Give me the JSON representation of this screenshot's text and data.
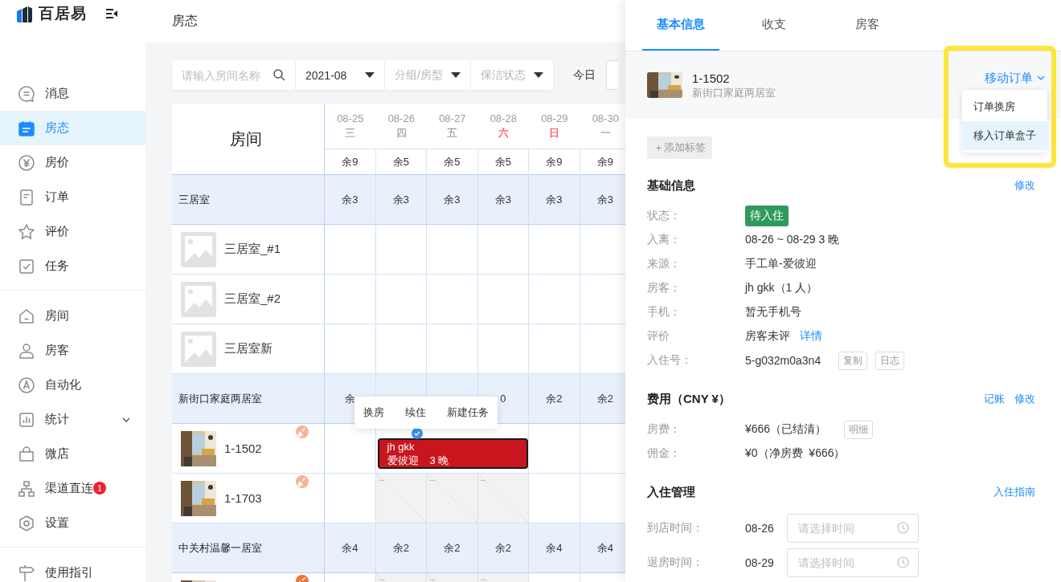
{
  "sidebar": {
    "brand": "百居易",
    "groups": [
      {
        "items": [
          {
            "label": "消息",
            "selected": false,
            "submenu": false
          },
          {
            "label": "房态",
            "selected": true,
            "submenu": false
          },
          {
            "label": "房价",
            "selected": false,
            "submenu": false
          },
          {
            "label": "订单",
            "selected": false,
            "submenu": false
          },
          {
            "label": "评价",
            "selected": false,
            "submenu": false
          },
          {
            "label": "任务",
            "selected": false,
            "submenu": false
          }
        ]
      },
      {
        "items": [
          {
            "label": "房间",
            "selected": false,
            "submenu": false
          },
          {
            "label": "房客",
            "selected": false,
            "submenu": false
          },
          {
            "label": "自动化",
            "selected": false,
            "submenu": false
          },
          {
            "label": "统计",
            "selected": false,
            "submenu": true
          },
          {
            "label": "微店",
            "selected": false,
            "submenu": false
          },
          {
            "label": "渠道直连",
            "selected": false,
            "submenu": false,
            "badge": "1"
          },
          {
            "label": "设置",
            "selected": false,
            "submenu": false
          }
        ]
      },
      {
        "items": [
          {
            "label": "使用指引",
            "selected": false,
            "submenu": false
          }
        ]
      }
    ]
  },
  "page": {
    "title": "房态"
  },
  "toolbar": {
    "search": {
      "placeholder": "请输入房间名称"
    },
    "month": "2021-08",
    "group_filter": "分组/房型",
    "cleaning_filter": "保洁状态",
    "today": "今日"
  },
  "table": {
    "corner": "房间",
    "dates": [
      {
        "date": "08-25",
        "weekday": "三",
        "weekend": false
      },
      {
        "date": "08-26",
        "weekday": "四",
        "weekend": false
      },
      {
        "date": "08-27",
        "weekday": "五",
        "weekend": false
      },
      {
        "date": "08-28",
        "weekday": "六",
        "weekend": true
      },
      {
        "date": "08-29",
        "weekday": "日",
        "weekend": true
      },
      {
        "date": "08-30",
        "weekday": "一",
        "weekend": false
      }
    ],
    "totals": [
      "余9",
      "余5",
      "余5",
      "余5",
      "余9",
      "余9"
    ],
    "rows": [
      {
        "kind": "group",
        "name": "三居室",
        "cells": [
          "余3",
          "余3",
          "余3",
          "余3",
          "余3",
          "余3"
        ]
      },
      {
        "kind": "room",
        "name": "三居室_#1",
        "photo": false,
        "cells": [
          {
            "kind": "empty"
          },
          {
            "kind": "empty"
          },
          {
            "kind": "empty"
          },
          {
            "kind": "empty"
          },
          {
            "kind": "empty"
          },
          {
            "kind": "empty"
          }
        ]
      },
      {
        "kind": "room",
        "name": "三居室_#2",
        "photo": false,
        "cells": [
          {
            "kind": "empty"
          },
          {
            "kind": "empty"
          },
          {
            "kind": "empty"
          },
          {
            "kind": "empty"
          },
          {
            "kind": "empty"
          },
          {
            "kind": "empty"
          }
        ]
      },
      {
        "kind": "room",
        "name": "三居室新",
        "photo": false,
        "cells": [
          {
            "kind": "empty"
          },
          {
            "kind": "empty"
          },
          {
            "kind": "empty"
          },
          {
            "kind": "empty"
          },
          {
            "kind": "empty"
          },
          {
            "kind": "empty"
          }
        ]
      },
      {
        "kind": "group",
        "name": "新街口家庭两居室",
        "cells": [
          "余",
          null,
          null,
          "0",
          "余2",
          "余2"
        ]
      },
      {
        "kind": "room",
        "name": "1-1502",
        "photo": true,
        "cleaning": {
          "color": "#f6b496"
        },
        "cells": [
          {
            "kind": "empty"
          },
          {
            "kind": "booking",
            "guest": "jh gkk",
            "channel": "爱彼迎",
            "nights": "3 晚",
            "selected": true,
            "menu": [
              "换房",
              "续住",
              "新建任务"
            ]
          },
          {
            "kind": "booked"
          },
          {
            "kind": "booked"
          },
          {
            "kind": "empty"
          },
          {
            "kind": "empty"
          }
        ]
      },
      {
        "kind": "room",
        "name": "1-1703",
        "photo": true,
        "cleaning": {
          "color": "#f6b496"
        },
        "cells": [
          {
            "kind": "empty"
          },
          {
            "kind": "blocked",
            "note": "..."
          },
          {
            "kind": "blocked",
            "note": "..."
          },
          {
            "kind": "blocked",
            "note": "..."
          },
          {
            "kind": "empty"
          },
          {
            "kind": "empty"
          }
        ]
      },
      {
        "kind": "group",
        "name": "中关村温馨一居室",
        "cells": [
          "余4",
          "余2",
          "余2",
          "余2",
          "余4",
          "余4"
        ]
      },
      {
        "kind": "room",
        "photo": true,
        "cleaning": {
          "color": "#ef7636"
        },
        "cells": [
          {
            "kind": "empty"
          },
          {
            "kind": "blocked",
            "note": "..."
          },
          {
            "kind": "blocked",
            "note": "..."
          },
          {
            "kind": "blocked",
            "note": "..."
          },
          {
            "kind": "empty"
          },
          {
            "kind": "empty"
          }
        ]
      }
    ]
  },
  "order_panel": {
    "tabs": [
      {
        "label": "基本信息",
        "selected": true
      },
      {
        "label": "收支",
        "selected": false
      },
      {
        "label": "房客",
        "selected": false
      }
    ],
    "room": {
      "name": "1-1502",
      "group": "新街口家庭两居室"
    },
    "move_menu": {
      "label": "移动订单",
      "expanded": true,
      "highlighted": true,
      "options": [
        {
          "label": "订单换房",
          "selected": false
        },
        {
          "label": "移入订单盒子",
          "selected": true
        }
      ]
    },
    "add_tag": "＋添加标签",
    "sections": [
      {
        "title": "基础信息",
        "actions": [
          "修改"
        ],
        "fields": [
          {
            "kind": "status",
            "label": "状态：",
            "value": "待入住"
          },
          {
            "kind": "text",
            "label": "入离：",
            "value": "08-26 ~ 08-29 3 晚"
          },
          {
            "kind": "text",
            "label": "来源：",
            "value": "手工单-爱彼迎"
          },
          {
            "kind": "text",
            "label": "房客：",
            "value": "jh gkk（1 人）"
          },
          {
            "kind": "text",
            "label": "手机：",
            "value": "暂无手机号"
          },
          {
            "kind": "text",
            "label": "评价",
            "value": "房客未评",
            "link": "详情"
          },
          {
            "kind": "text",
            "label": "入住号：",
            "value": "5-g032m0a3n4",
            "buttons": [
              "复制",
              "日志"
            ]
          }
        ]
      },
      {
        "title": "费用（CNY ¥）",
        "actions": [
          "记账",
          "修改"
        ],
        "fields": [
          {
            "kind": "text",
            "label": "房费：",
            "value": "¥666（已结清）",
            "buttons": [
              "明细"
            ]
          },
          {
            "kind": "text",
            "label": "佣金：",
            "value": "¥0（净房费  ¥666）"
          }
        ]
      },
      {
        "title": "入住管理",
        "actions": [
          "入住指南"
        ],
        "fields": [
          {
            "kind": "time",
            "label": "到店时间：",
            "value": "08-26",
            "placeholder": "请选择时间"
          },
          {
            "kind": "time",
            "label": "退房时间：",
            "value": "08-29",
            "placeholder": "请选择时间"
          }
        ]
      }
    ]
  }
}
